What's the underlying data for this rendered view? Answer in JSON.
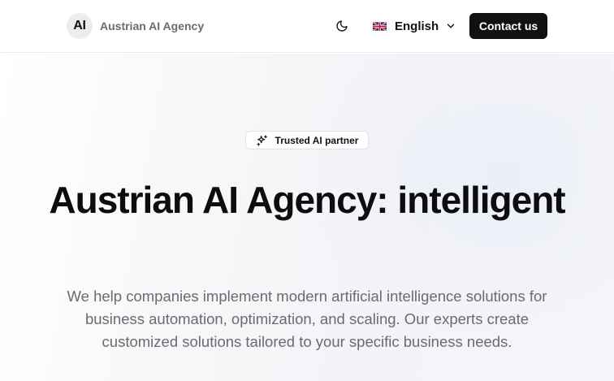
{
  "header": {
    "logo_badge": "AI",
    "logo_text": "Austrian AI Agency",
    "language": "English",
    "contact_label": "Contact us",
    "theme_icon": "moon-icon",
    "flag_icon": "uk-flag-icon",
    "chevron_icon": "chevron-down-icon"
  },
  "hero": {
    "badge_icon": "sparkles-icon",
    "badge_label": "Trusted AI partner",
    "title": "Austrian AI Agency: intelligent",
    "description": "We help companies implement modern artificial intelligence solutions for business automation, optimization, and scaling. Our experts create customized solutions tailored to your specific business needs."
  },
  "colors": {
    "primary_button": "#111111",
    "text_muted": "#6a6a70"
  }
}
